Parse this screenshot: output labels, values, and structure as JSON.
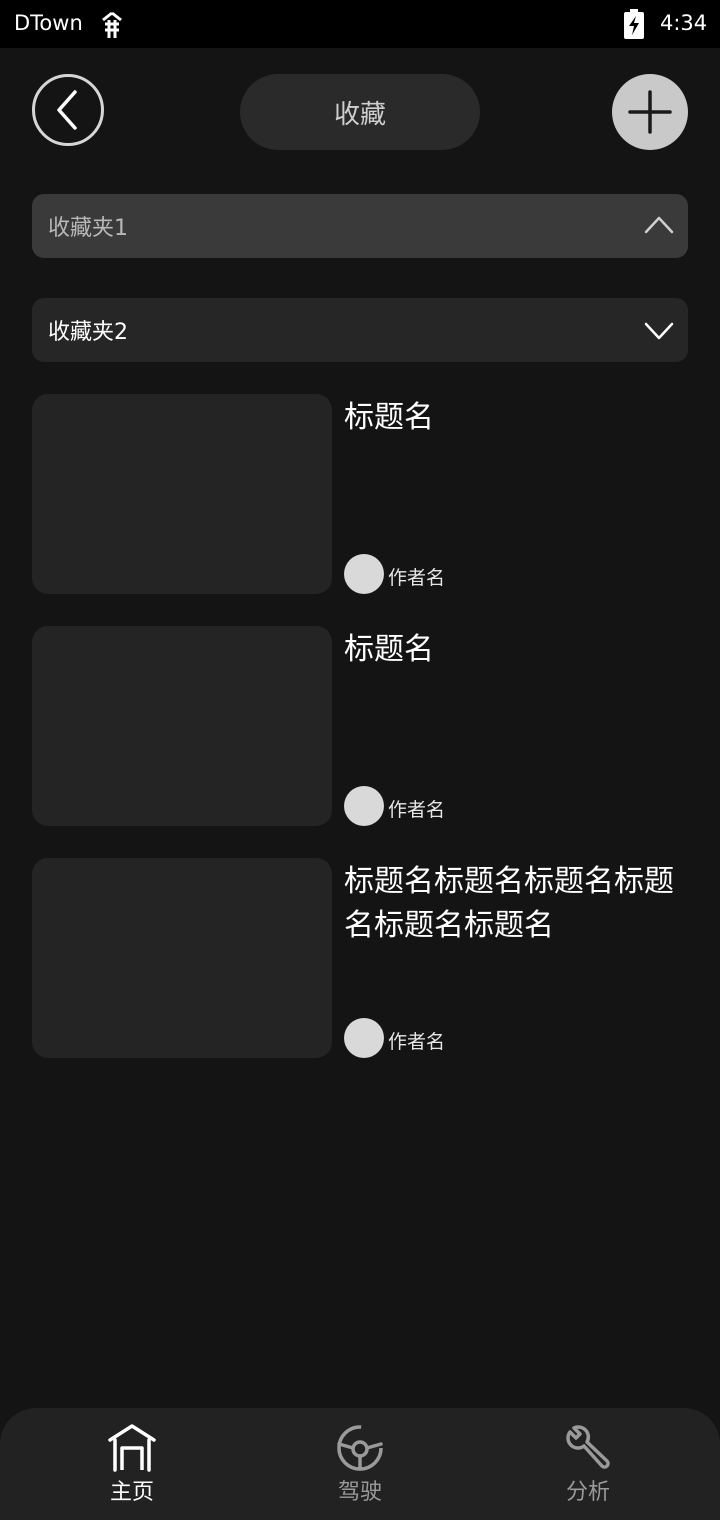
{
  "status_bar": {
    "app_name": "DTown",
    "time": "4:34"
  },
  "header": {
    "title": "收藏"
  },
  "folders": [
    {
      "label": "收藏夹1",
      "state": "expanded"
    },
    {
      "label": "收藏夹2",
      "state": "collapsed"
    }
  ],
  "items": [
    {
      "title": "标题名",
      "author": "作者名"
    },
    {
      "title": "标题名",
      "author": "作者名"
    },
    {
      "title": "标题名标题名标题名标题名标题名标题名",
      "author": "作者名"
    }
  ],
  "tabs": [
    {
      "label": "主页",
      "icon": "home-icon",
      "active": true
    },
    {
      "label": "驾驶",
      "icon": "steering-wheel-icon",
      "active": false
    },
    {
      "label": "分析",
      "icon": "wrench-icon",
      "active": false
    }
  ],
  "colors": {
    "background": "#141414",
    "card": "#242424",
    "accent": "#c9c9c9"
  }
}
